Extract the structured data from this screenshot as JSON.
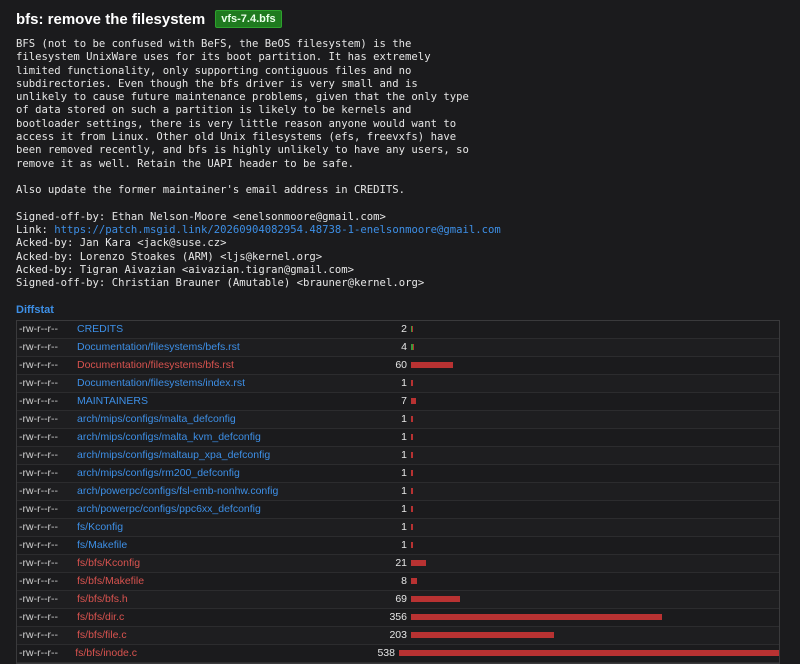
{
  "commit": {
    "title": "bfs: remove the filesystem",
    "badge": "vfs-7.4.bfs",
    "message_lines": [
      "BFS (not to be confused with BeFS, the BeOS filesystem) is the",
      "filesystem UnixWare uses for its boot partition. It has extremely",
      "limited functionality, only supporting contiguous files and no",
      "subdirectories. Even though the bfs driver is very small and is",
      "unlikely to cause future maintenance problems, given that the only type",
      "of data stored on such a partition is likely to be kernels and",
      "bootloader settings, there is very little reason anyone would want to",
      "access it from Linux. Other old Unix filesystems (efs, freevxfs) have",
      "been removed recently, and bfs is highly unlikely to have any users, so",
      "remove it as well. Retain the UAPI header to be safe."
    ],
    "extra_line": "Also update the former maintainer's email address in CREDITS.",
    "tags": [
      {
        "key": "Signed-off-by:",
        "value": "Ethan Nelson-Moore <enelsonmoore@gmail.com>",
        "link": false
      },
      {
        "key": "Link:",
        "value": "https://patch.msgid.link/20260904082954.48738-1-enelsonmoore@gmail.com",
        "link": true
      },
      {
        "key": "Acked-by:",
        "value": "Jan Kara <jack@suse.cz>",
        "link": false
      },
      {
        "key": "Acked-by:",
        "value": "Lorenzo Stoakes (ARM) <ljs@kernel.org>",
        "link": false
      },
      {
        "key": "Acked-by:",
        "value": "Tigran Aivazian <aivazian.tigran@gmail.com>",
        "link": false
      },
      {
        "key": "Signed-off-by:",
        "value": "Christian Brauner (Amutable) <brauner@kernel.org>",
        "link": false
      }
    ]
  },
  "diffstat": {
    "label": "Diffstat",
    "colors": {
      "added": "#3a9a3a",
      "deleted": "#b83232",
      "modified_link": "#3d8fe6",
      "deleted_link": "#d9534f"
    },
    "files": [
      {
        "mode": "-rw-r--r--",
        "path": "CREDITS",
        "changes": "2",
        "status": "modified",
        "added": 1,
        "deleted": 1
      },
      {
        "mode": "-rw-r--r--",
        "path": "Documentation/filesystems/befs.rst",
        "changes": "4",
        "status": "modified",
        "added": 2,
        "deleted": 2
      },
      {
        "mode": "-rw-r--r--",
        "path": "Documentation/filesystems/bfs.rst",
        "changes": "60",
        "status": "deleted",
        "added": 0,
        "deleted": 60
      },
      {
        "mode": "-rw-r--r--",
        "path": "Documentation/filesystems/index.rst",
        "changes": "1",
        "status": "modified",
        "added": 0,
        "deleted": 1
      },
      {
        "mode": "-rw-r--r--",
        "path": "MAINTAINERS",
        "changes": "7",
        "status": "modified",
        "added": 0,
        "deleted": 7
      },
      {
        "mode": "-rw-r--r--",
        "path": "arch/mips/configs/malta_defconfig",
        "changes": "1",
        "status": "modified",
        "added": 0,
        "deleted": 1
      },
      {
        "mode": "-rw-r--r--",
        "path": "arch/mips/configs/malta_kvm_defconfig",
        "changes": "1",
        "status": "modified",
        "added": 0,
        "deleted": 1
      },
      {
        "mode": "-rw-r--r--",
        "path": "arch/mips/configs/maltaup_xpa_defconfig",
        "changes": "1",
        "status": "modified",
        "added": 0,
        "deleted": 1
      },
      {
        "mode": "-rw-r--r--",
        "path": "arch/mips/configs/rm200_defconfig",
        "changes": "1",
        "status": "modified",
        "added": 0,
        "deleted": 1
      },
      {
        "mode": "-rw-r--r--",
        "path": "arch/powerpc/configs/fsl-emb-nonhw.config",
        "changes": "1",
        "status": "modified",
        "added": 0,
        "deleted": 1
      },
      {
        "mode": "-rw-r--r--",
        "path": "arch/powerpc/configs/ppc6xx_defconfig",
        "changes": "1",
        "status": "modified",
        "added": 0,
        "deleted": 1
      },
      {
        "mode": "-rw-r--r--",
        "path": "fs/Kconfig",
        "changes": "1",
        "status": "modified",
        "added": 0,
        "deleted": 1
      },
      {
        "mode": "-rw-r--r--",
        "path": "fs/Makefile",
        "changes": "1",
        "status": "modified",
        "added": 0,
        "deleted": 1
      },
      {
        "mode": "-rw-r--r--",
        "path": "fs/bfs/Kconfig",
        "changes": "21",
        "status": "deleted",
        "added": 0,
        "deleted": 21
      },
      {
        "mode": "-rw-r--r--",
        "path": "fs/bfs/Makefile",
        "changes": "8",
        "status": "deleted",
        "added": 0,
        "deleted": 8
      },
      {
        "mode": "-rw-r--r--",
        "path": "fs/bfs/bfs.h",
        "changes": "69",
        "status": "deleted",
        "added": 0,
        "deleted": 69
      },
      {
        "mode": "-rw-r--r--",
        "path": "fs/bfs/dir.c",
        "changes": "356",
        "status": "deleted",
        "added": 0,
        "deleted": 356
      },
      {
        "mode": "-rw-r--r--",
        "path": "fs/bfs/file.c",
        "changes": "203",
        "status": "deleted",
        "added": 0,
        "deleted": 203
      },
      {
        "mode": "-rw-r--r--",
        "path": "fs/bfs/inode.c",
        "changes": "538",
        "status": "deleted",
        "added": 0,
        "deleted": 538
      }
    ]
  }
}
